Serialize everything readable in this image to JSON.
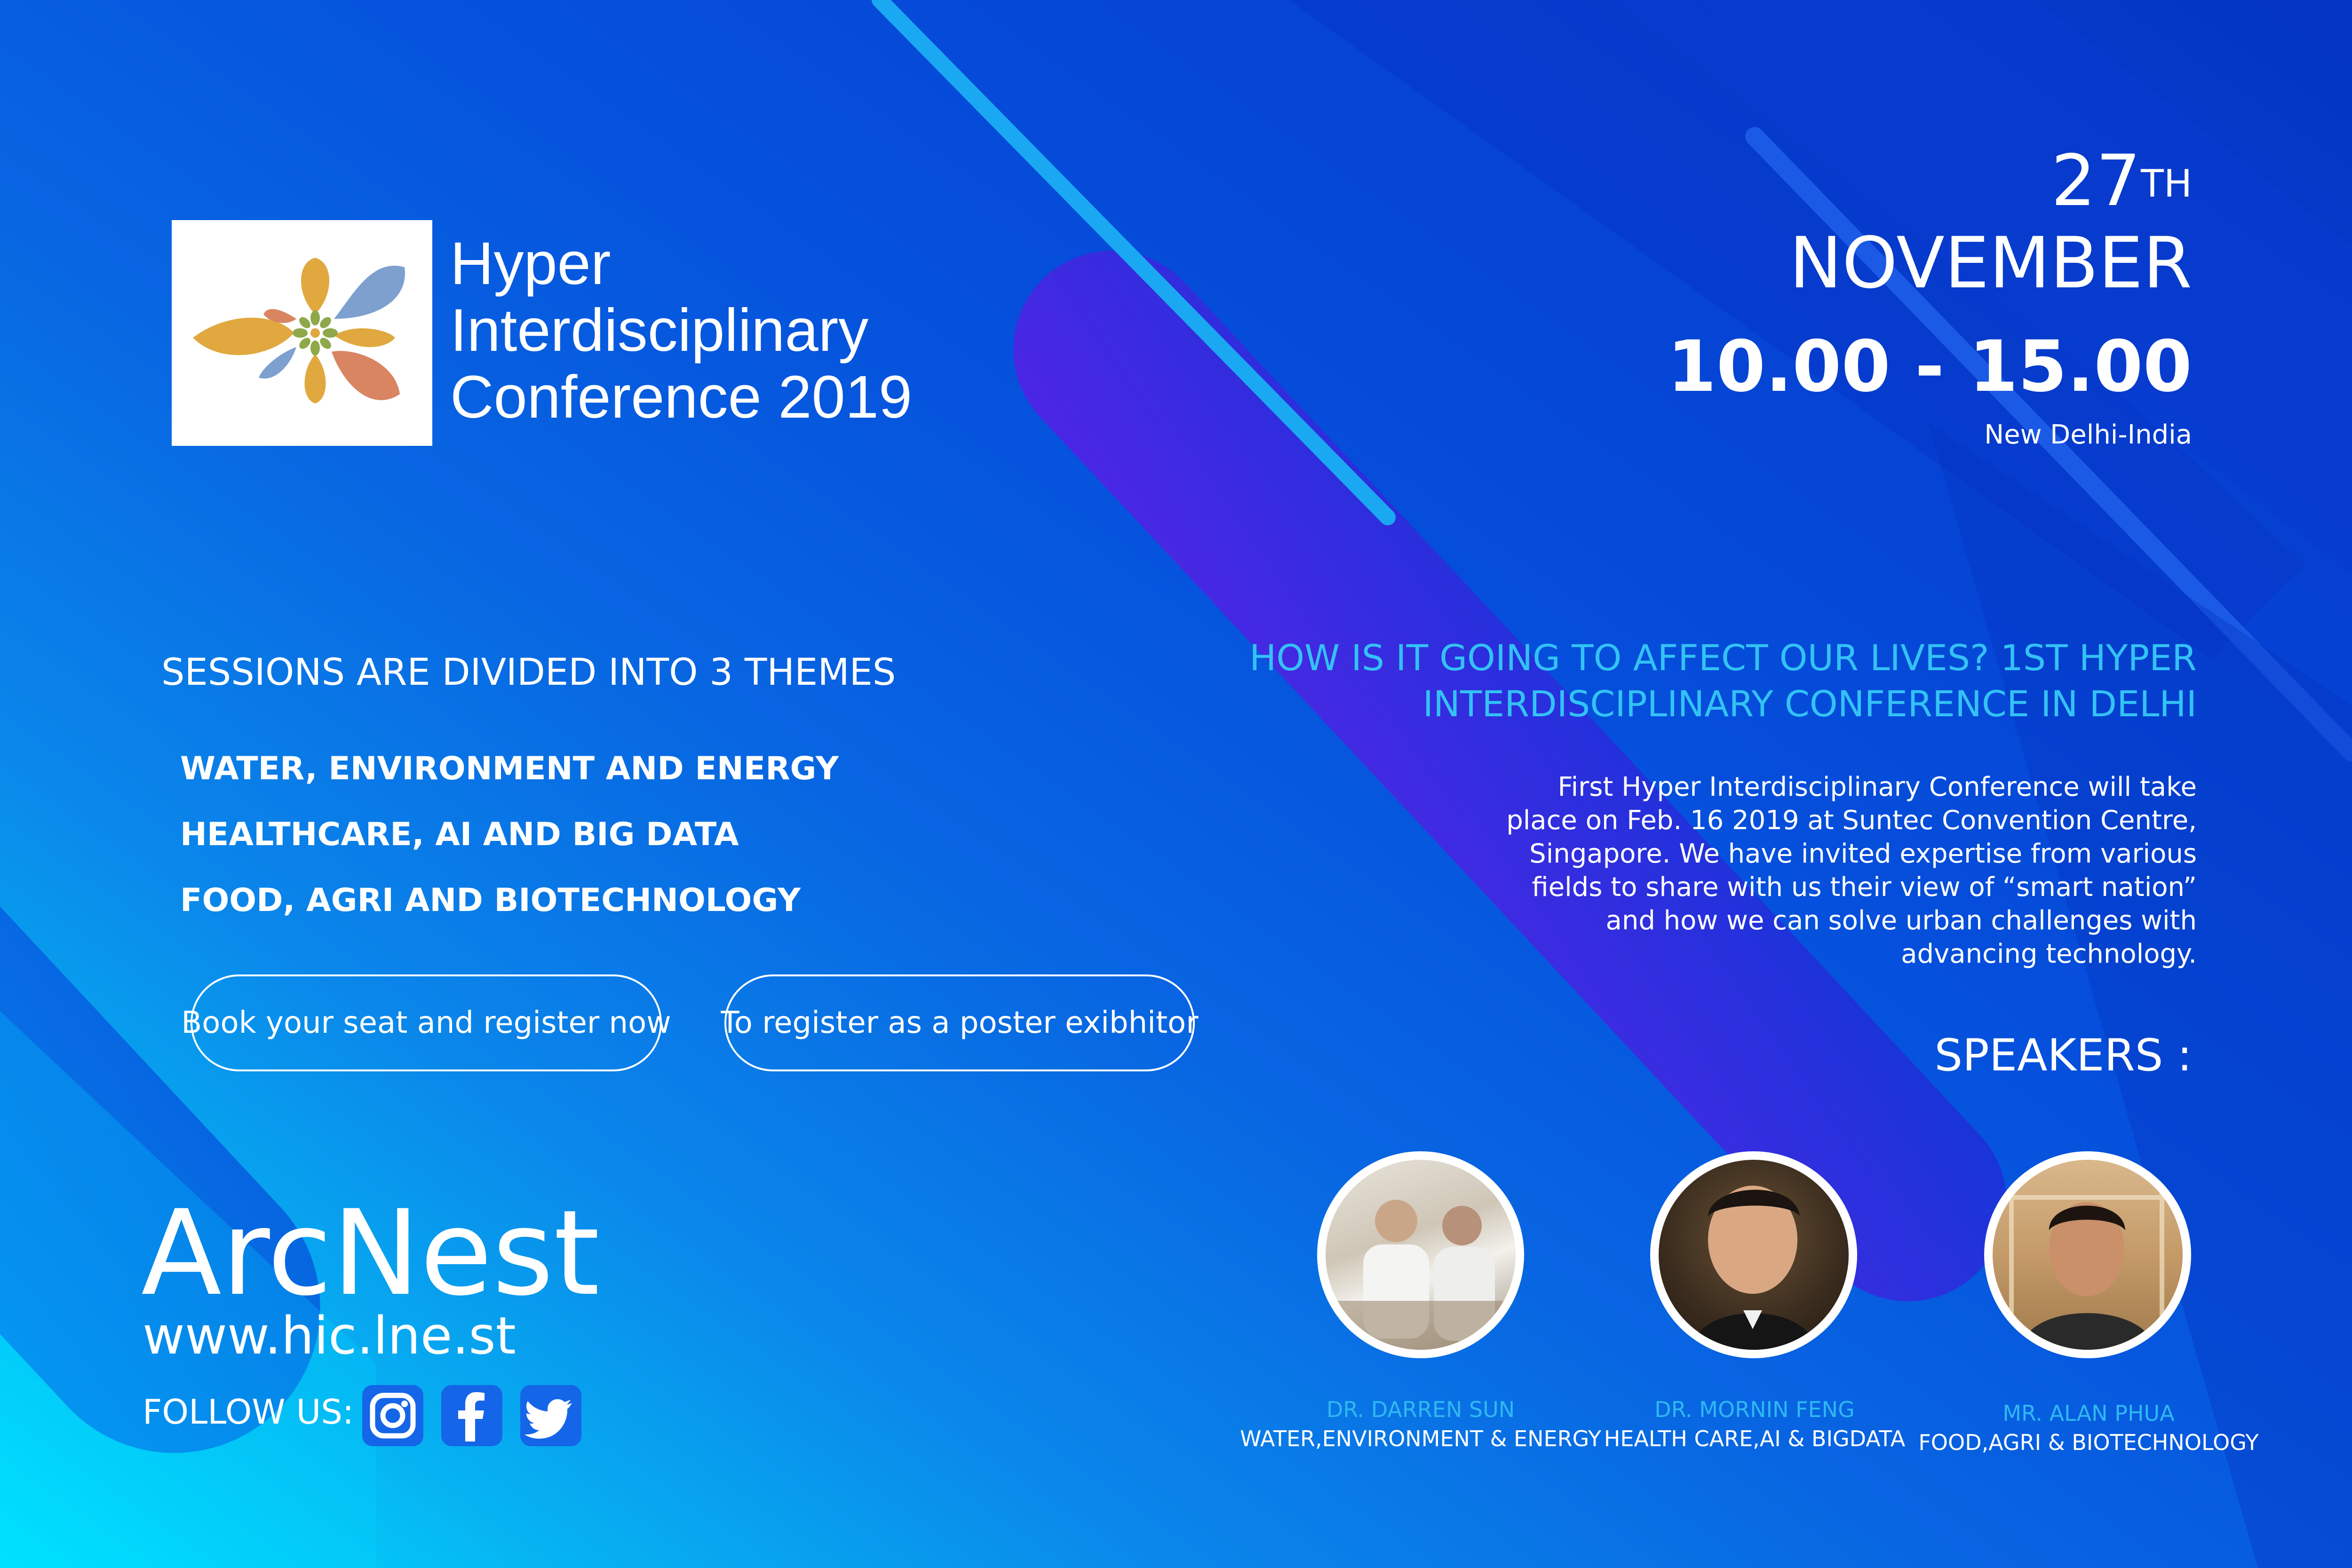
{
  "conference": {
    "title_lines": [
      "Hyper",
      "Interdisciplinary",
      "Conference 2019"
    ]
  },
  "event": {
    "day": "27",
    "day_suffix": "TH",
    "month": "NOVEMBER",
    "time": "10.00 - 15.00",
    "location": "New Delhi-India"
  },
  "themes": {
    "heading": "SESSIONS ARE DIVIDED INTO 3 THEMES",
    "items": [
      "WATER, ENVIRONMENT AND ENERGY",
      "HEALTHCARE, AI AND BIG DATA",
      "FOOD, AGRI AND BIOTECHNOLOGY"
    ]
  },
  "buttons": {
    "book_seat": "Book your seat and register now",
    "poster_exhibitor": "To register as a poster exibhitor"
  },
  "headline": {
    "lines": [
      "HOW IS IT GOING TO AFFECT OUR LIVES? 1ST HYPER",
      "INTERDISCIPLINARY CONFERENCE IN DELHI"
    ]
  },
  "description": "First Hyper Interdisciplinary Conference will take place on Feb. 16 2019 at Suntec Convention Centre, Singapore. We have invited expertise from various fields to share with us their view of “smart nation” and how we can solve urban challenges with advancing technology.",
  "speakers": {
    "heading": "SPEAKERS :",
    "list": [
      {
        "name": "DR. DARREN SUN",
        "topic": "WATER,ENVIRONMENT & ENERGY"
      },
      {
        "name": "DR. MORNIN FENG",
        "topic": "HEALTH CARE,AI & BIGDATA"
      },
      {
        "name": "MR. ALAN PHUA",
        "topic": "FOOD,AGRI & BIOTECHNOLOGY"
      }
    ]
  },
  "brand": {
    "name": "ArcNest",
    "url": "www.hic.lne.st",
    "follow_label": "FOLLOW US:"
  },
  "colors": {
    "accent_text": "#33c2f6",
    "background_dark": "#0434c2",
    "background_light": "#00e6ff"
  }
}
